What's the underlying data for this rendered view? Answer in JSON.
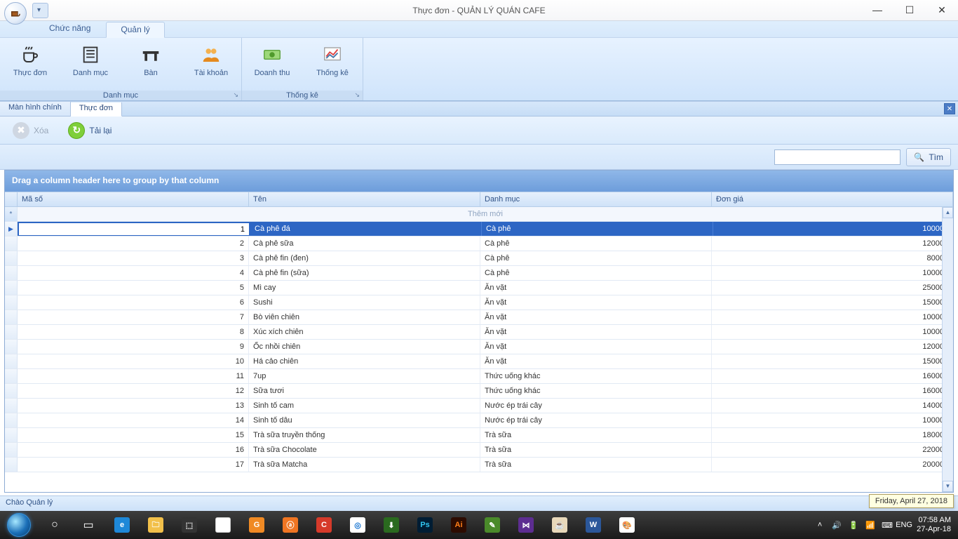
{
  "window": {
    "title": "Thực đơn - QUẢN LÝ QUÁN CAFE"
  },
  "ribbon_tabs": {
    "func": "Chức năng",
    "manage": "Quản lý"
  },
  "ribbon": {
    "group1_title": "Danh mục",
    "group2_title": "Thống kê",
    "menu": "Thực đơn",
    "category": "Danh mục",
    "table": "Bàn",
    "account": "Tài khoản",
    "revenue": "Doanh thu",
    "stats": "Thống kê"
  },
  "doc_tabs": {
    "main": "Màn hình chính",
    "menu": "Thực đơn"
  },
  "toolbar": {
    "delete": "Xóa",
    "reload": "Tải lại",
    "search_btn": "Tìm"
  },
  "grid": {
    "group_hint": "Drag a column header here to group by that column",
    "headers": {
      "id": "Mã số",
      "name": "Tên",
      "cat": "Danh mục",
      "price": "Đơn giá"
    },
    "new_row": "Thêm mới",
    "rows": [
      {
        "id": "1",
        "name": "Cà phê đá",
        "cat": "Cà phê",
        "price": "10000"
      },
      {
        "id": "2",
        "name": "Cà phê sữa",
        "cat": "Cà phê",
        "price": "12000"
      },
      {
        "id": "3",
        "name": "Cà phê fin (đen)",
        "cat": "Cà phê",
        "price": "8000"
      },
      {
        "id": "4",
        "name": "Cà phê fin (sữa)",
        "cat": "Cà phê",
        "price": "10000"
      },
      {
        "id": "5",
        "name": "Mì cay",
        "cat": "Ăn vặt",
        "price": "25000"
      },
      {
        "id": "6",
        "name": "Sushi",
        "cat": "Ăn vặt",
        "price": "15000"
      },
      {
        "id": "7",
        "name": "Bò viên chiên",
        "cat": "Ăn vặt",
        "price": "10000"
      },
      {
        "id": "8",
        "name": "Xúc xích chiên",
        "cat": "Ăn vặt",
        "price": "10000"
      },
      {
        "id": "9",
        "name": "Ốc nhồi chiên",
        "cat": "Ăn vặt",
        "price": "12000"
      },
      {
        "id": "10",
        "name": "Há cảo chiên",
        "cat": "Ăn vặt",
        "price": "15000"
      },
      {
        "id": "11",
        "name": "7up",
        "cat": "Thức uống khác",
        "price": "16000"
      },
      {
        "id": "12",
        "name": "Sữa tươi",
        "cat": "Thức uống khác",
        "price": "16000"
      },
      {
        "id": "13",
        "name": "Sinh tố cam",
        "cat": "Nước ép trái cây",
        "price": "14000"
      },
      {
        "id": "14",
        "name": "Sinh tố dâu",
        "cat": "Nước ép trái cây",
        "price": "10000"
      },
      {
        "id": "15",
        "name": "Trà sữa truyền thống",
        "cat": "Trà sữa",
        "price": "18000"
      },
      {
        "id": "16",
        "name": "Trà sữa Chocolate",
        "cat": "Trà sữa",
        "price": "22000"
      },
      {
        "id": "17",
        "name": "Trà sữa Matcha",
        "cat": "Trà sữa",
        "price": "20000"
      }
    ]
  },
  "status": "Chào Quản lý",
  "tooltip": "Friday, April 27, 2018",
  "tray": {
    "lang": "ENG",
    "time": "07:58 AM",
    "date": "27-Apr-18"
  }
}
